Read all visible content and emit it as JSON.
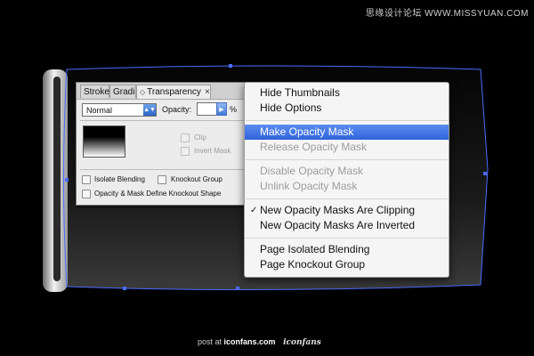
{
  "watermark": "思缘设计论坛 WWW.MISSYUAN.COM",
  "panel": {
    "tabs": [
      "Stroke",
      "Gradi",
      "Transparency"
    ],
    "tab_close": "×",
    "menu_icon": "≡",
    "blend_mode": "Normal",
    "opacity_label": "Opacity:",
    "opacity_value": "",
    "opacity_unit": "%",
    "clip_label": "Clip",
    "invert_mask_label": "Invert Mask",
    "isolate_blending_label": "Isolate Blending",
    "knockout_group_label": "Knockout Group",
    "opacity_mask_knockout_label": "Opacity & Mask Define Knockout Shape"
  },
  "menu": {
    "items": [
      {
        "label": "Hide Thumbnails",
        "state": "enabled"
      },
      {
        "label": "Hide Options",
        "state": "enabled"
      },
      {
        "label": "Make Opacity Mask",
        "state": "highlighted"
      },
      {
        "label": "Release Opacity Mask",
        "state": "disabled"
      },
      {
        "label": "Disable Opacity Mask",
        "state": "disabled"
      },
      {
        "label": "Unlink Opacity Mask",
        "state": "disabled"
      },
      {
        "label": "New Opacity Masks Are Clipping",
        "state": "checked"
      },
      {
        "label": "New Opacity Masks Are Inverted",
        "state": "enabled"
      },
      {
        "label": "Page Isolated Blending",
        "state": "enabled"
      },
      {
        "label": "Page Knockout Group",
        "state": "enabled"
      }
    ],
    "check_glyph": "✓"
  },
  "footer": {
    "prefix": "post at",
    "site": "iconfans.com",
    "logo": "iconfans"
  },
  "colors": {
    "highlight": "#2f63dc",
    "selection_path": "#4b6bff"
  }
}
